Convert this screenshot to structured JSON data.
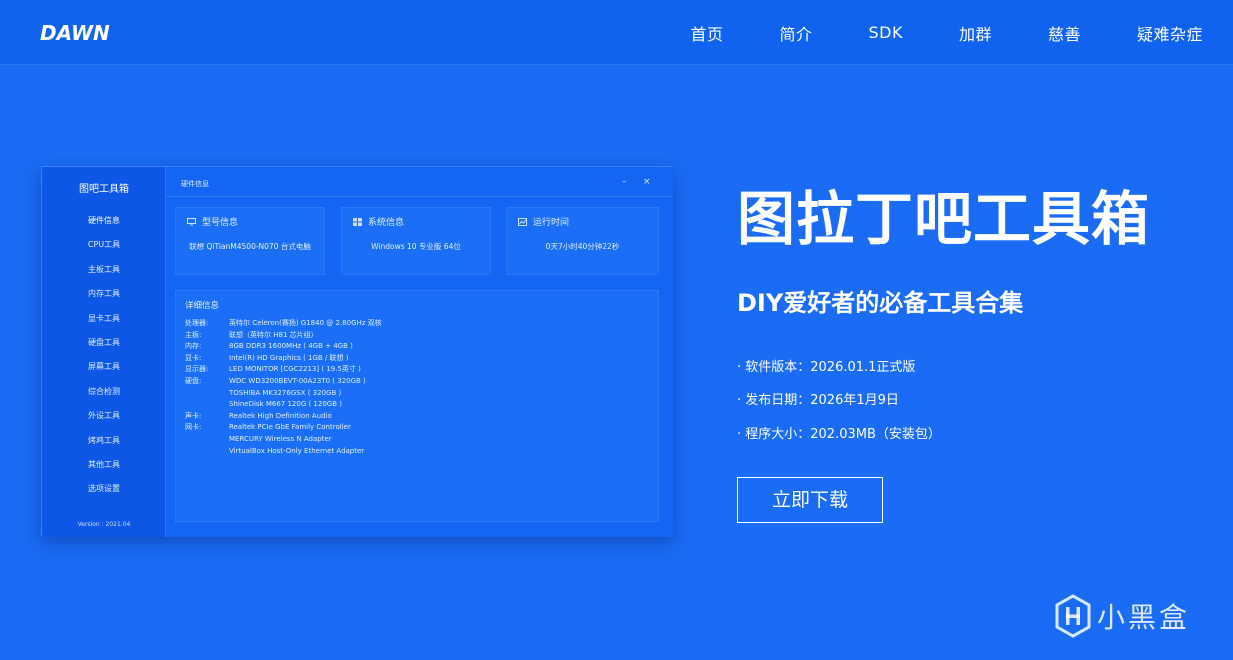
{
  "nav": {
    "logo_text": "DAWN",
    "items": [
      "首页",
      "简介",
      "SDK",
      "加群",
      "慈善",
      "疑难杂症"
    ]
  },
  "app": {
    "title": "图吧工具箱",
    "sidebar": [
      "硬件信息",
      "CPU工具",
      "主板工具",
      "内存工具",
      "显卡工具",
      "硬盘工具",
      "屏幕工具",
      "综合检测",
      "外设工具",
      "烤鸡工具",
      "其他工具",
      "选项设置"
    ],
    "version": "Version : 2021.04",
    "window_title": "硬件信息",
    "min_glyph": "–",
    "close_glyph": "×",
    "cards": [
      {
        "label": "型号信息",
        "value": "联想 QiTianM4500-N070 台式电脑",
        "icon": "monitor-icon"
      },
      {
        "label": "系统信息",
        "value": "Windows 10 专业版 64位",
        "icon": "windows-icon"
      },
      {
        "label": "运行时间",
        "value": "0天7小时40分钟22秒",
        "icon": "chart-icon"
      }
    ],
    "detail": {
      "title": "详细信息",
      "rows": [
        {
          "k": "处理器:",
          "v": "英特尔 Celeron(赛扬) G1840 @ 2.80GHz 双核"
        },
        {
          "k": "主板:",
          "v": "联想（英特尔 H81 芯片组）"
        },
        {
          "k": "内存:",
          "v": "8GB DDR3 1600MHz ( 4GB + 4GB )"
        },
        {
          "k": "显卡:",
          "v": "Intel(R) HD Graphics ( 1GB / 联想 )"
        },
        {
          "k": "显示器:",
          "v": "LED MONITOR [CGC2213] ( 19.5英寸 )"
        },
        {
          "k": "硬盘:",
          "v": "WDC WD3200BEVT-00A23T0 ( 320GB )"
        },
        {
          "k": "",
          "v": "TOSHIBA MK3276GSX ( 320GB )"
        },
        {
          "k": "",
          "v": "ShineDisk M667 120G ( 120GB )"
        },
        {
          "k": "声卡:",
          "v": "Realtek High Definition Audio"
        },
        {
          "k": "网卡:",
          "v": "Realtek PCIe GbE Family Controller"
        },
        {
          "k": "",
          "v": "MERCURY Wireless N Adapter"
        },
        {
          "k": "",
          "v": "VirtualBox Host-Only Ethernet Adapter"
        }
      ]
    }
  },
  "hero": {
    "title": "图拉丁吧工具箱",
    "subtitle": "DIY爱好者的必备工具合集",
    "info": [
      "· 软件版本：2026.01.1正式版",
      "· 发布日期：2026年1月9日",
      "· 程序大小：202.03MB（安装包）"
    ],
    "download_label": "立即下载"
  },
  "watermark": {
    "text": "小黑盒"
  }
}
